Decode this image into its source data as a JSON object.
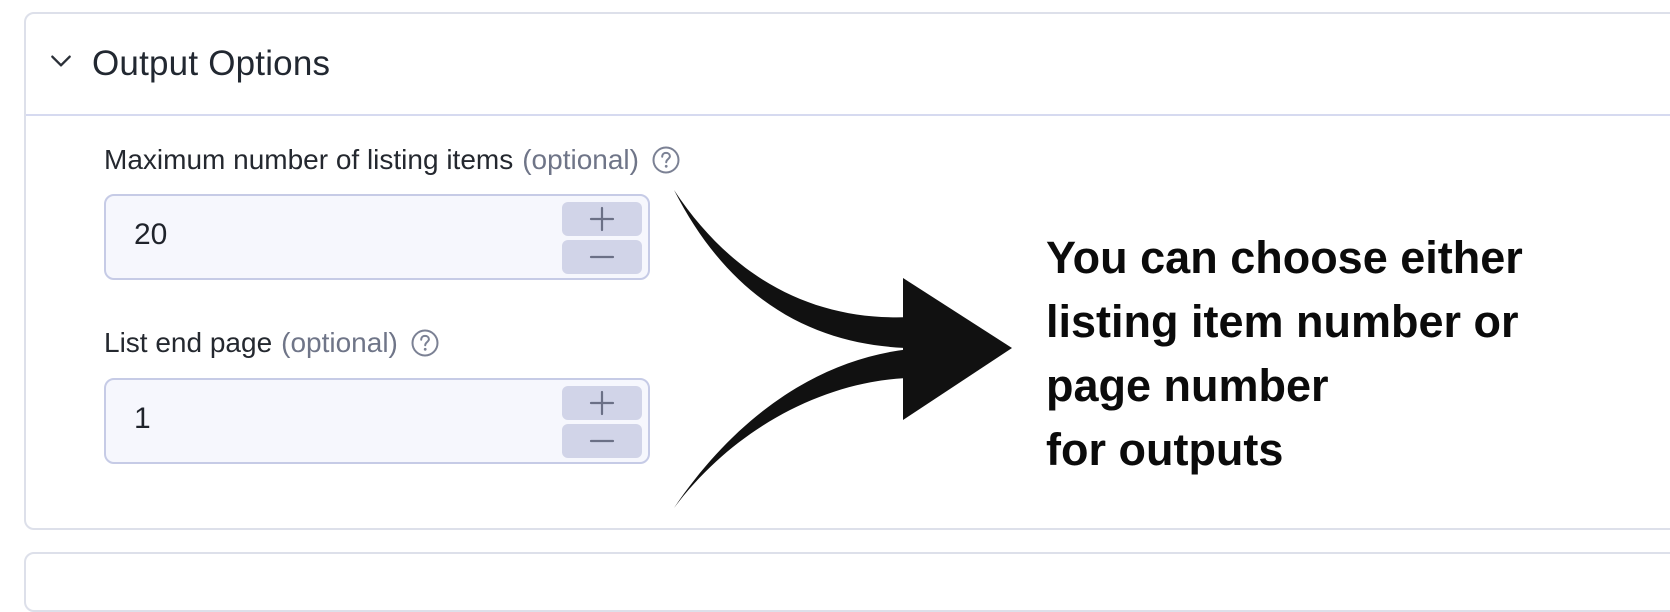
{
  "section": {
    "title": "Output Options",
    "expanded": true
  },
  "fields": [
    {
      "label": "Maximum number of listing items",
      "optional_text": "(optional)",
      "value": "20"
    },
    {
      "label": "List end page",
      "optional_text": "(optional)",
      "value": "1"
    }
  ],
  "callout": {
    "lines": [
      "You can choose either",
      "listing item number or",
      "page number",
      "for outputs"
    ]
  },
  "icons": {
    "chevron": "chevron-down-icon",
    "help": "question-circle-icon",
    "increment": "plus-icon",
    "decrement": "minus-icon"
  },
  "colors": {
    "border": "#dde0ea",
    "input_bg": "#f6f7fd",
    "stepper_bg": "#d1d4e8",
    "muted_text": "#6f7588",
    "arrow": "#111111"
  }
}
